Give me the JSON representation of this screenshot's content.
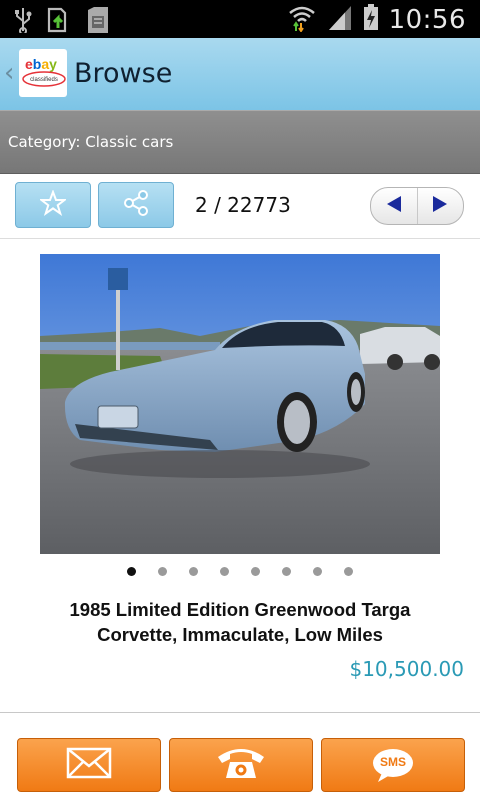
{
  "status_bar": {
    "time": "10:56",
    "icons": [
      "usb-icon",
      "upload-icon",
      "sd-card-icon",
      "wifi-icon",
      "signal-icon",
      "battery-charging-icon"
    ]
  },
  "action_bar": {
    "title": "Browse",
    "logo_text_top": "ebay",
    "logo_text_bottom": "classifieds",
    "back_icon": "chevron-left-icon"
  },
  "category": {
    "label": "Category: Classic cars"
  },
  "toolbar": {
    "favorite_icon": "star-icon",
    "share_icon": "share-icon",
    "counter": "2 / 22773",
    "prev_icon": "arrow-left-icon",
    "next_icon": "arrow-right-icon"
  },
  "listing": {
    "photo_count": 8,
    "active_photo": 1,
    "title": "1985 Limited Edition Greenwood Targa Corvette, Immaculate, Low Miles",
    "price": "$10,500.00"
  },
  "contact": {
    "email_icon": "envelope-icon",
    "phone_icon": "telephone-icon",
    "sms_label": "SMS"
  },
  "colors": {
    "accent_blue": "#7cc4e6",
    "price_teal": "#2a9ab5",
    "contact_orange": "#f07a14"
  }
}
